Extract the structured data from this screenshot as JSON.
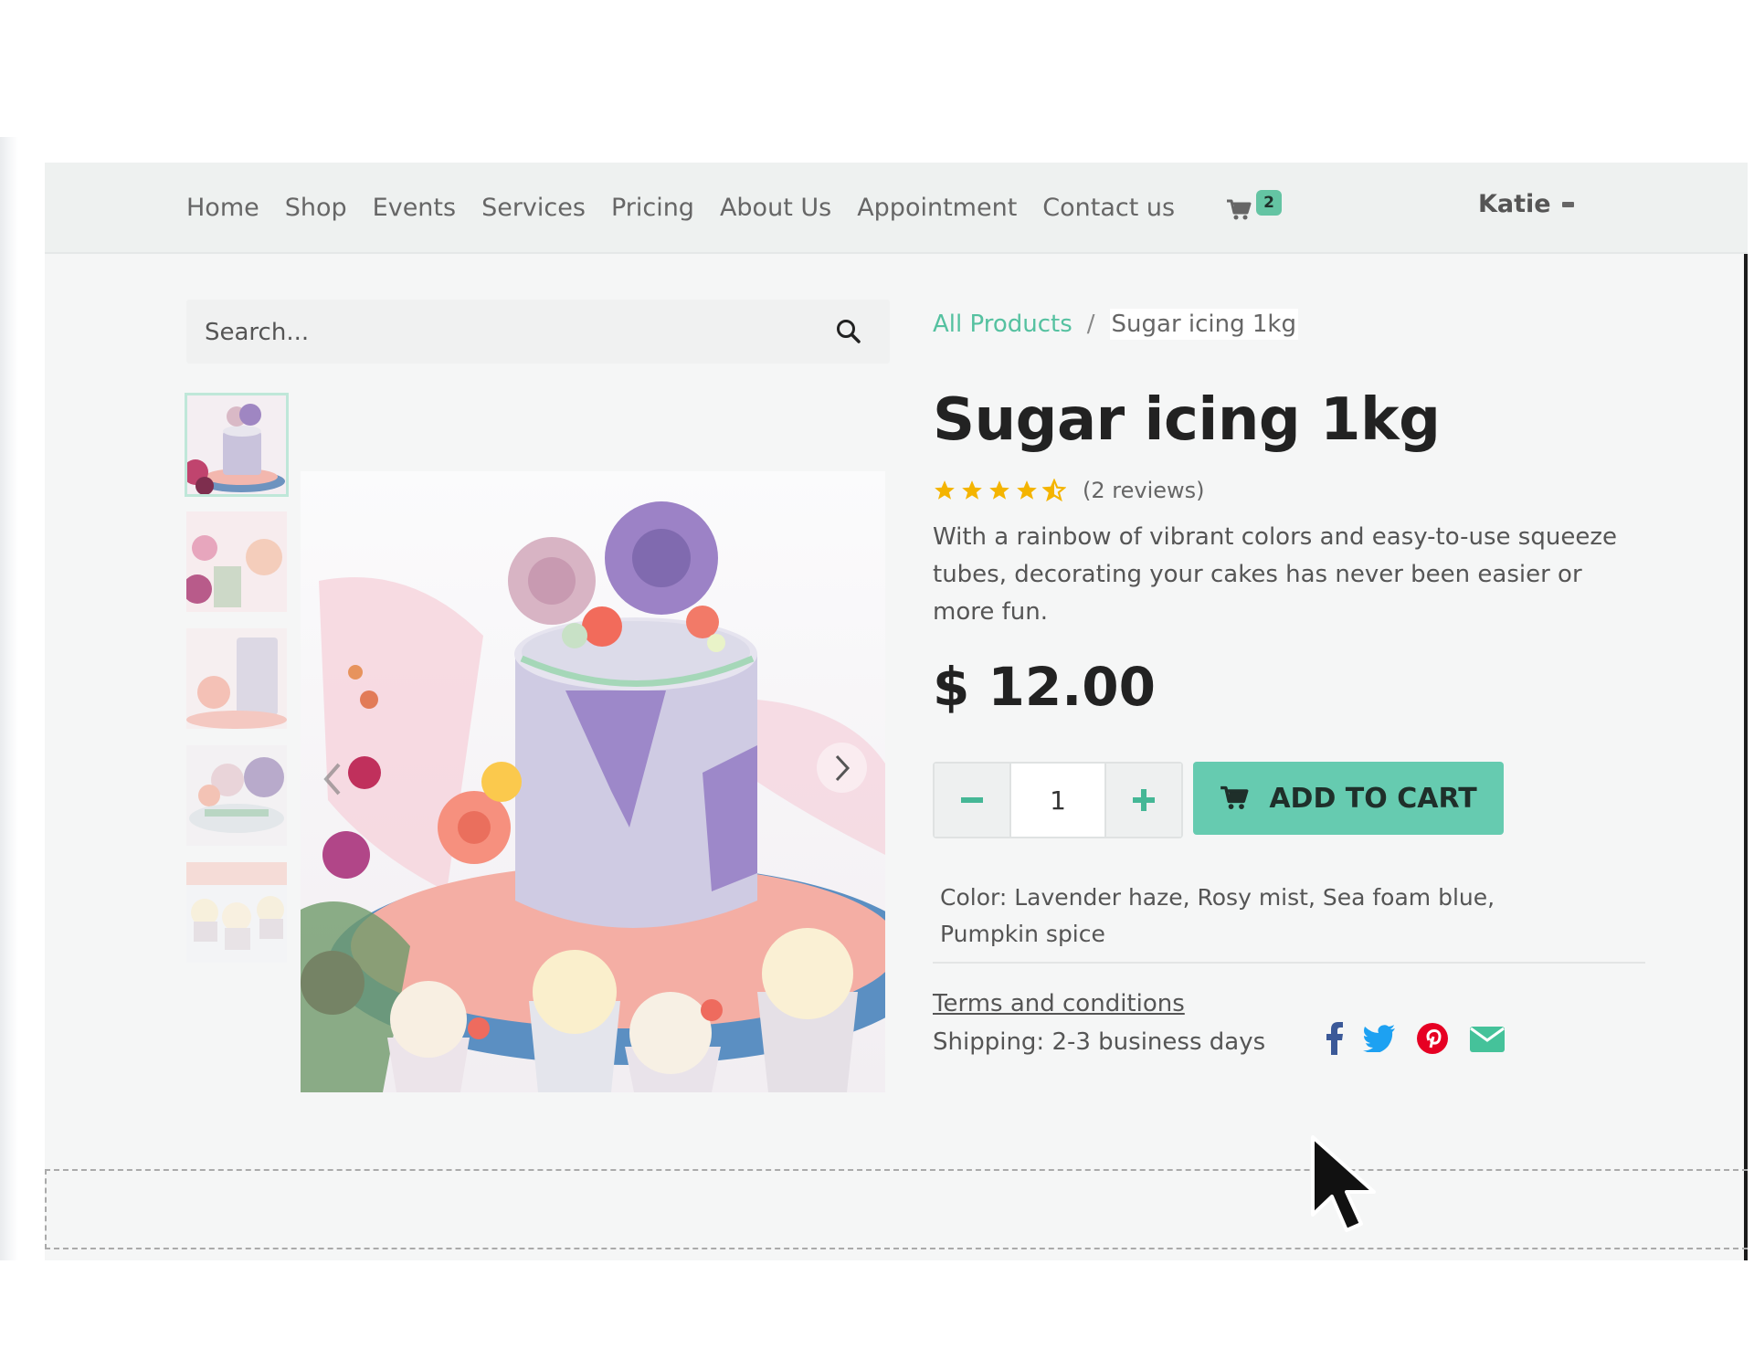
{
  "navbar": {
    "items": [
      {
        "label": "Home"
      },
      {
        "label": "Shop"
      },
      {
        "label": "Events"
      },
      {
        "label": "Services"
      },
      {
        "label": "Pricing"
      },
      {
        "label": "About Us"
      },
      {
        "label": "Appointment"
      },
      {
        "label": "Contact us"
      }
    ],
    "cart": {
      "icon": "shopping-cart-icon",
      "count": "2"
    },
    "user": {
      "name": "Katie",
      "icon": "caret-down-icon"
    }
  },
  "search": {
    "placeholder": "Search...",
    "value": "",
    "icon": "search-icon"
  },
  "breadcrumb": {
    "parent": "All Products",
    "separator": "/",
    "current": "Sugar icing 1kg"
  },
  "product": {
    "title": "Sugar icing 1kg",
    "rating": 4.5,
    "rating_max": 5,
    "review_count": "(2 reviews)",
    "description": "With a rainbow of vibrant colors and easy-to-use squeeze tubes, decorating your cakes has never been easier or more fun.",
    "price": "$ 12.00",
    "quantity": "1",
    "add_to_cart_label": "ADD TO CART",
    "color_info": "Color: Lavender haze, Rosy mist, Sea foam blue, Pumpkin spice",
    "terms_label": "Terms and conditions",
    "shipping": "Shipping: 2-3 business days"
  },
  "gallery": {
    "thumbnails": [
      "cake-front",
      "flowers-closeup",
      "cake-side",
      "cake-topper",
      "cupcakes"
    ],
    "active_index": 0,
    "main_image": "lavender-cake-with-cupcakes"
  },
  "share": {
    "icons": [
      "facebook-icon",
      "twitter-icon",
      "pinterest-icon",
      "email-icon"
    ]
  },
  "colors": {
    "accent": "#66cbb0",
    "link": "#55c1a0",
    "star": "#f4b400",
    "facebook": "#3b5998",
    "twitter": "#1da1f2",
    "pinterest": "#e60023",
    "email": "#45c29a"
  }
}
